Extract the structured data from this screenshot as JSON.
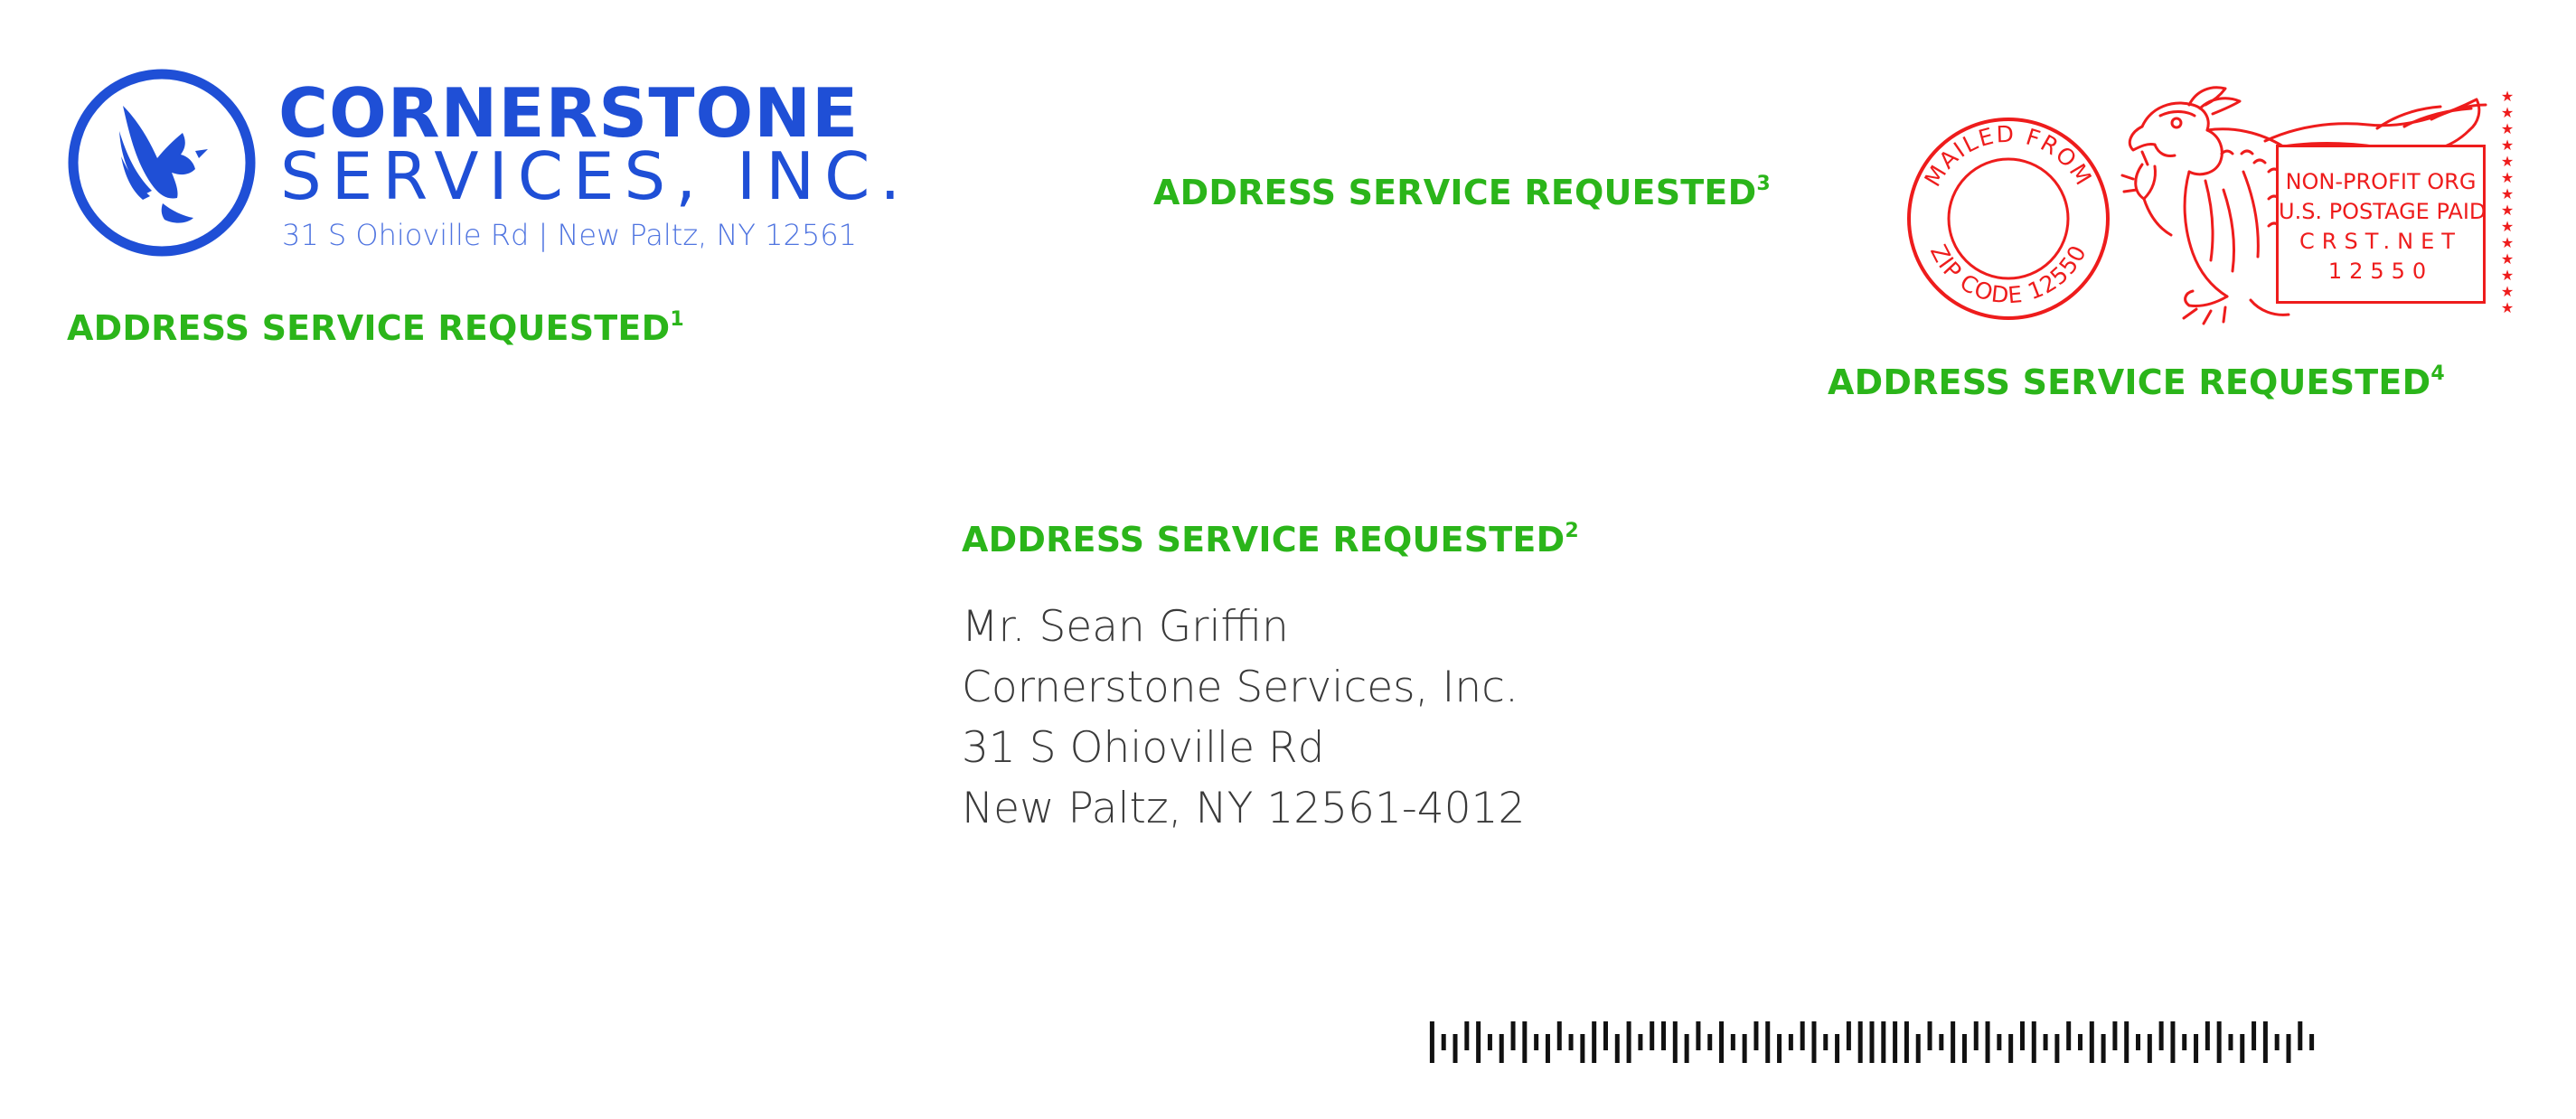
{
  "sender": {
    "company_line1": "CORNERSTONE",
    "company_line2": "SERVICES, INC.",
    "address": "31 S Ohioville Rd | New Paltz, NY 12561"
  },
  "endorsements": [
    {
      "text": "ADDRESS SERVICE REQUESTED",
      "footnote": "1"
    },
    {
      "text": "ADDRESS SERVICE REQUESTED",
      "footnote": "2"
    },
    {
      "text": "ADDRESS SERVICE REQUESTED",
      "footnote": "3"
    },
    {
      "text": "ADDRESS SERVICE REQUESTED",
      "footnote": "4"
    }
  ],
  "recipient": {
    "name": "Mr. Sean Griffin",
    "company": "Cornerstone Services, Inc.",
    "street": "31 S Ohioville Rd",
    "city_state_zip": "New Paltz, NY 12561-4012"
  },
  "postmark": {
    "top_text": "MAILED FROM",
    "bottom_text": "ZIP CODE 12550"
  },
  "permit": {
    "line1": "NON-PROFIT ORG",
    "line2": "U.S. POSTAGE PAID",
    "line3": "CRST.NET",
    "line4": "12550"
  },
  "barcode": {
    "pattern": "FTDAFTDAFTDATDFADFTAAFDATFTDAFDTAFTDAFFFFFDATFDAFTDAFTDATFDAFTDAFTDAFTDAFTDAT"
  },
  "colors": {
    "brand_blue": "#1f4fd6",
    "endorsement_green": "#2bb51a",
    "postage_red": "#ee1c1c",
    "text_gray": "#3a3a3a"
  }
}
